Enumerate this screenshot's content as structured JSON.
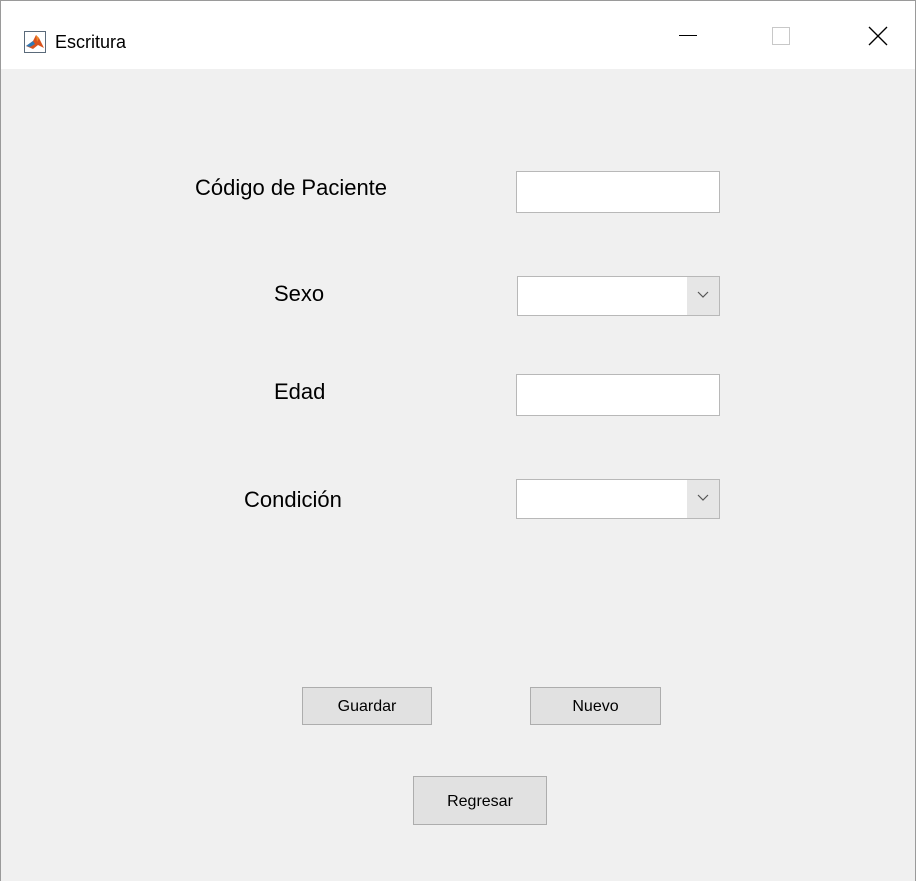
{
  "window": {
    "title": "Escritura",
    "icon": "matlab-icon",
    "controls": [
      "minimize-icon",
      "maximize-icon",
      "close-icon"
    ]
  },
  "form": {
    "codigo": {
      "label": "Código de Paciente",
      "value": ""
    },
    "sexo": {
      "label": "Sexo",
      "selected": ""
    },
    "edad": {
      "label": "Edad",
      "value": ""
    },
    "condicion": {
      "label": "Condición",
      "selected": ""
    }
  },
  "buttons": {
    "guardar": "Guardar",
    "nuevo": "Nuevo",
    "regresar": "Regresar"
  }
}
